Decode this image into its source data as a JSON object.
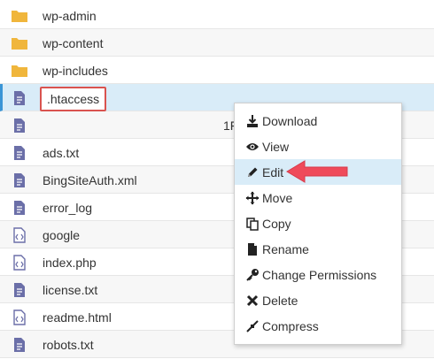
{
  "files": [
    {
      "name": "wp-admin",
      "type": "folder"
    },
    {
      "name": "wp-content",
      "type": "folder"
    },
    {
      "name": "wp-includes",
      "type": "folder"
    },
    {
      "name": ".htaccess",
      "type": "text",
      "selected": true
    },
    {
      "name": "",
      "type": "text",
      "size": "1F"
    },
    {
      "name": "ads.txt",
      "type": "text"
    },
    {
      "name": "BingSiteAuth.xml",
      "type": "text"
    },
    {
      "name": "error_log",
      "type": "text"
    },
    {
      "name": "google",
      "type": "code"
    },
    {
      "name": "index.php",
      "type": "code"
    },
    {
      "name": "license.txt",
      "type": "text"
    },
    {
      "name": "readme.html",
      "type": "code"
    },
    {
      "name": "robots.txt",
      "type": "text"
    }
  ],
  "context_menu": {
    "items": [
      {
        "label": "Download",
        "icon": "download-icon"
      },
      {
        "label": "View",
        "icon": "eye-icon"
      },
      {
        "label": "Edit",
        "icon": "pencil-icon",
        "active": true
      },
      {
        "label": "Move",
        "icon": "move-icon"
      },
      {
        "label": "Copy",
        "icon": "copy-icon"
      },
      {
        "label": "Rename",
        "icon": "file-icon"
      },
      {
        "label": "Change Permissions",
        "icon": "key-icon"
      },
      {
        "label": "Delete",
        "icon": "delete-icon"
      },
      {
        "label": "Compress",
        "icon": "compress-icon"
      }
    ]
  },
  "colors": {
    "folder": "#f0b63c",
    "file": "#6b6fa8",
    "selection": "#d9ecf8",
    "highlight_border": "#d9534f",
    "arrow": "#ef4a5a"
  }
}
